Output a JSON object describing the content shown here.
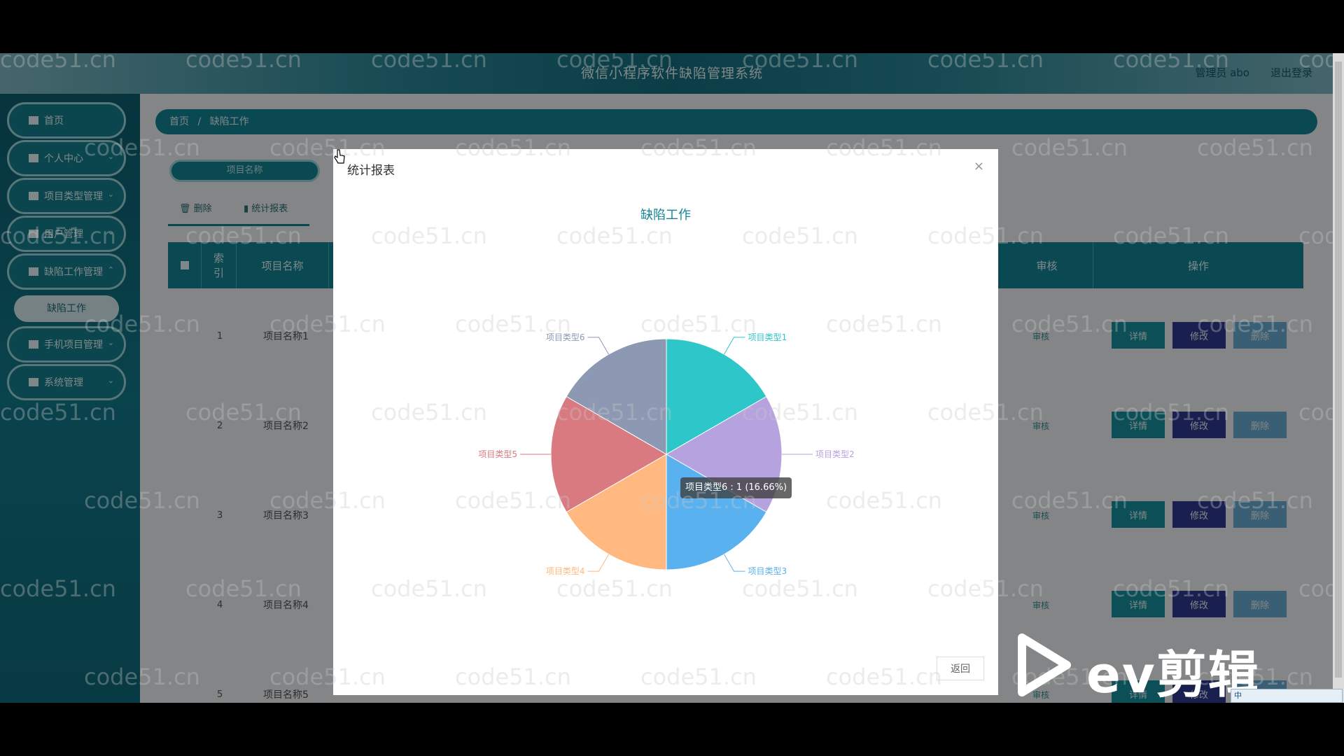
{
  "app": {
    "title": "微信小程序软件缺陷管理系统",
    "user_label": "管理员  abo",
    "logout_label": "退出登录"
  },
  "sidebar": {
    "items": [
      {
        "label": "首页"
      },
      {
        "label": "个人中心"
      },
      {
        "label": "项目类型管理"
      },
      {
        "label": "用户管理"
      },
      {
        "label": "缺陷工作管理"
      },
      {
        "label": "手机项目管理"
      },
      {
        "label": "系统管理"
      }
    ],
    "submenu_active": "缺陷工作"
  },
  "breadcrumb": {
    "home": "首页",
    "sep": "/",
    "current": "缺陷工作"
  },
  "search": {
    "placeholder": "项目名称"
  },
  "toolbar": {
    "delete_label": "删除",
    "stats_label": "统计报表"
  },
  "table": {
    "headers": {
      "index": "索\n引",
      "name": "项目名称",
      "audit": "审核",
      "ops": "操作"
    },
    "rows": [
      {
        "index": "1",
        "name": "项目名称1"
      },
      {
        "index": "2",
        "name": "项目名称2"
      },
      {
        "index": "3",
        "name": "项目名称3"
      },
      {
        "index": "4",
        "name": "项目名称4"
      },
      {
        "index": "5",
        "name": "项目名称5"
      }
    ],
    "audit_label": "审核",
    "detail_label": "详情",
    "edit_label": "修改",
    "delete_label": "删除"
  },
  "watermark": "code51.cn",
  "dialog": {
    "title": "统计报表",
    "close_label": "×",
    "back_label": "返回",
    "tooltip": "项目类型6 : 1 (16.66%)"
  },
  "chart_data": {
    "type": "pie",
    "title": "缺陷工作",
    "slices": [
      {
        "label": "项目类型1",
        "value": 1,
        "color": "#2ec7c9"
      },
      {
        "label": "项目类型2",
        "value": 1,
        "color": "#b6a2de"
      },
      {
        "label": "项目类型3",
        "value": 1,
        "color": "#5ab1ef"
      },
      {
        "label": "项目类型4",
        "value": 1,
        "color": "#ffb980"
      },
      {
        "label": "项目类型5",
        "value": 1,
        "color": "#d87a80"
      },
      {
        "label": "项目类型6",
        "value": 1,
        "color": "#8d98b3"
      }
    ],
    "highlighted": "项目类型6"
  },
  "overlay": {
    "brand": "ev剪辑",
    "ime": "中"
  }
}
